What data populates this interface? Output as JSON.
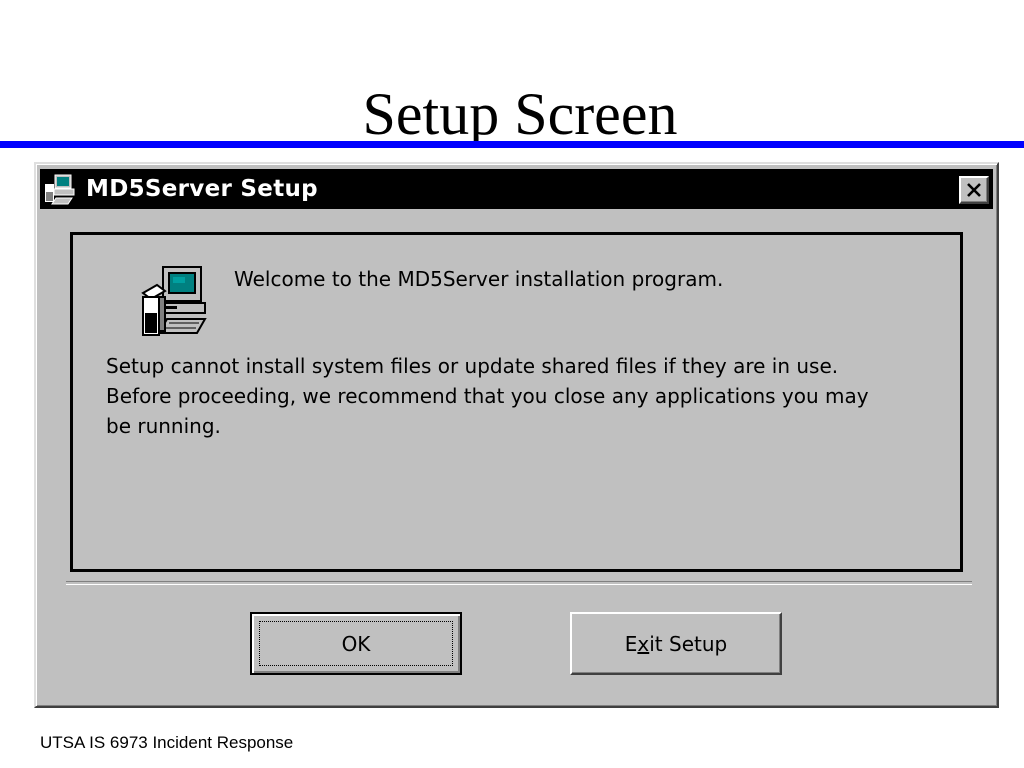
{
  "slide": {
    "title": "Setup Screen",
    "footer": "UTSA IS 6973 Incident Response",
    "rule_color": "#0000ff"
  },
  "dialog": {
    "title": "MD5Server Setup",
    "title_icon": "computer-setup-icon",
    "close_icon": "close-icon",
    "welcome": "Welcome to the MD5Server installation program.",
    "message_lines": [
      "Setup cannot install system files or update shared files if they are in use.",
      "Before proceeding, we recommend that you close any applications you may",
      "be running."
    ],
    "buttons": {
      "ok": "OK",
      "exit_prefix": "E",
      "exit_mnemonic": "x",
      "exit_suffix": "it Setup"
    }
  }
}
